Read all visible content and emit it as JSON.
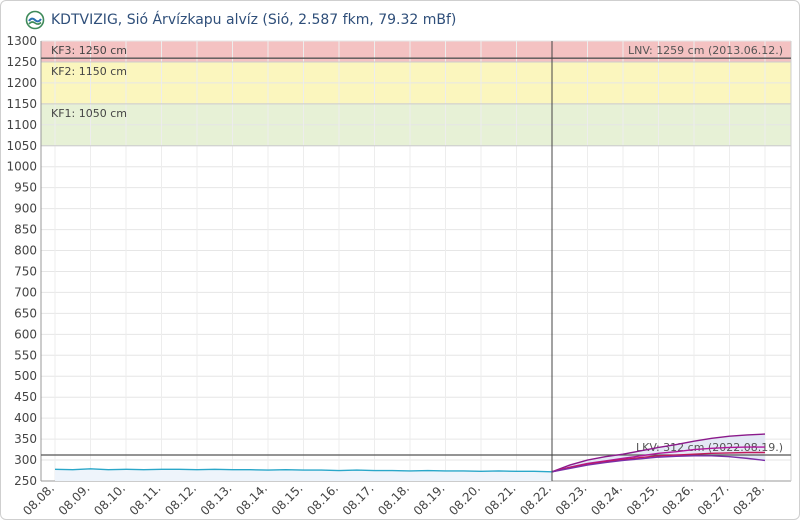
{
  "header": {
    "title": "KDTVIZIG, Sió Árvízkapu alvíz (Sió, 2.587 fkm, 79.32 mBf)",
    "logo_icon": "water-gauge-logo-icon"
  },
  "chart_data": {
    "type": "line",
    "title": "KDTVIZIG, Sió Árvízkapu alvíz (Sió, 2.587 fkm, 79.32 mBf)",
    "xlabel": "",
    "ylabel": "",
    "ylim": [
      250,
      1300
    ],
    "grid": true,
    "categories": [
      "08.08.",
      "08.09.",
      "08.10.",
      "08.11.",
      "08.12.",
      "08.13.",
      "08.14.",
      "08.15.",
      "08.16.",
      "08.17.",
      "08.18.",
      "08.19.",
      "08.20.",
      "08.21.",
      "08.22.",
      "08.23.",
      "08.24.",
      "08.25.",
      "08.26.",
      "08.27.",
      "08.28."
    ],
    "y_ticks": [
      250,
      300,
      350,
      400,
      450,
      500,
      550,
      600,
      650,
      700,
      750,
      800,
      850,
      900,
      950,
      1000,
      1050,
      1100,
      1150,
      1200,
      1250,
      1300
    ],
    "bands": [
      {
        "label": "KF3: 1250 cm",
        "from": 1250,
        "to": 1300,
        "color": "#f4c2c2"
      },
      {
        "label": "KF2: 1150 cm",
        "from": 1150,
        "to": 1250,
        "color": "#fbf6be"
      },
      {
        "label": "KF1: 1050 cm",
        "from": 1050,
        "to": 1150,
        "color": "#e7f1d6"
      }
    ],
    "reference_lines": [
      {
        "label": "LNV: 1259 cm (2013.06.12.)",
        "value": 1259,
        "color": "#555555"
      },
      {
        "label": "LKV: 312 cm (2022.08.19.)",
        "value": 312,
        "color": "#555555"
      }
    ],
    "now_marker": "08.22.",
    "series": [
      {
        "color": "#2aa7c9",
        "x": [
          0,
          0.5,
          1,
          1.5,
          2,
          2.5,
          3,
          3.5,
          4,
          4.5,
          5,
          5.5,
          6,
          6.5,
          7,
          7.5,
          8,
          8.5,
          9,
          9.5,
          10,
          10.5,
          11,
          11.5,
          12,
          12.5,
          13,
          13.5,
          14
        ],
        "values": [
          278,
          277,
          279,
          277,
          278,
          277,
          278,
          278,
          277,
          278,
          277,
          277,
          276,
          277,
          276,
          276,
          275,
          276,
          275,
          275,
          274,
          275,
          274,
          274,
          273,
          274,
          273,
          273,
          272
        ]
      },
      {
        "color": "#8b1a8b",
        "x": [
          14,
          14.5,
          15,
          15.5,
          16,
          16.5,
          17,
          17.5,
          18,
          18.5,
          19,
          19.5,
          20
        ],
        "values": [
          272,
          288,
          300,
          308,
          314,
          322,
          330,
          337,
          345,
          352,
          357,
          360,
          362
        ]
      },
      {
        "color": "#b0179b",
        "x": [
          14,
          14.5,
          15,
          15.5,
          16,
          16.5,
          17,
          17.5,
          18,
          18.5,
          19,
          19.5,
          20
        ],
        "values": [
          272,
          283,
          292,
          298,
          304,
          310,
          316,
          320,
          325,
          328,
          330,
          331,
          331
        ]
      },
      {
        "color": "#c2185b",
        "x": [
          14,
          14.5,
          15,
          15.5,
          16,
          16.5,
          17,
          17.5,
          18,
          18.5,
          19,
          19.5,
          20
        ],
        "values": [
          272,
          282,
          290,
          296,
          301,
          306,
          310,
          312,
          314,
          316,
          317,
          318,
          318
        ]
      },
      {
        "color": "#7b2fa8",
        "x": [
          14,
          14.5,
          15,
          15.5,
          16,
          16.5,
          17,
          17.5,
          18,
          18.5,
          19,
          19.5,
          20
        ],
        "values": [
          272,
          280,
          288,
          294,
          299,
          303,
          307,
          309,
          310,
          310,
          308,
          304,
          299
        ]
      }
    ],
    "forecast_band": {
      "color": "#dde3f2",
      "x": [
        14,
        14.5,
        15,
        15.5,
        16,
        16.5,
        17,
        17.5,
        18,
        18.5,
        19,
        19.5,
        20
      ],
      "upper": [
        272,
        288,
        300,
        308,
        314,
        322,
        330,
        337,
        345,
        352,
        357,
        360,
        362
      ],
      "lower": [
        272,
        280,
        288,
        294,
        299,
        303,
        307,
        309,
        310,
        310,
        308,
        304,
        299
      ]
    }
  }
}
